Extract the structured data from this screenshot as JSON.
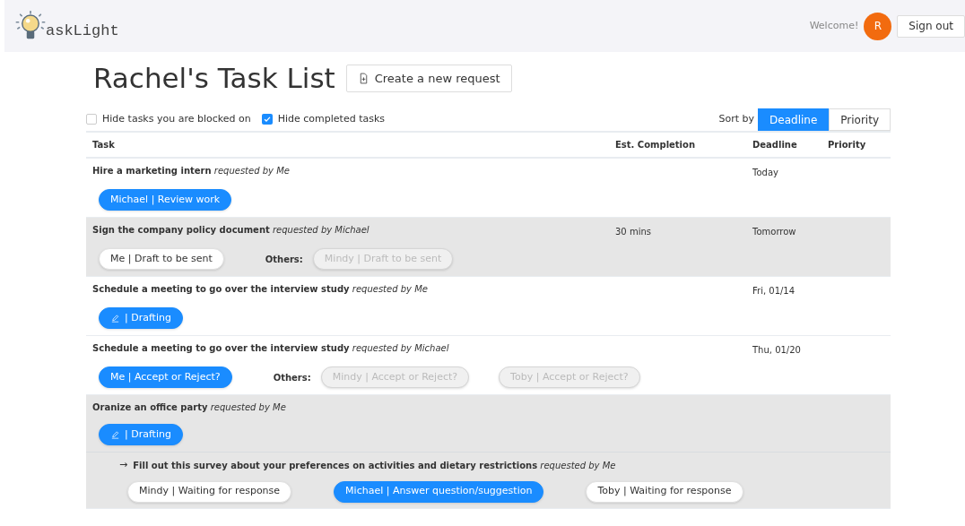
{
  "header": {
    "logo_text": "askLight",
    "welcome": "Welcome!",
    "avatar_initial": "R",
    "sign_out": "Sign out"
  },
  "page_title": "Rachel's Task List",
  "create_button": "Create a new request",
  "filters": [
    {
      "label": "Hide tasks you are blocked on",
      "checked": false
    },
    {
      "label": "Hide completed tasks",
      "checked": true
    }
  ],
  "sort": {
    "label": "Sort by",
    "options": [
      {
        "label": "Deadline",
        "selected": true
      },
      {
        "label": "Priority",
        "selected": false
      }
    ]
  },
  "table": {
    "columns": [
      "Task",
      "Est. Completion",
      "Deadline",
      "Priority"
    ],
    "rows": [
      {
        "title": "**Hire a marketing intern** *requested by Me*",
        "shaded": false,
        "est": "",
        "deadline": "Today",
        "mine": [
          {
            "label": "Michael | Review work",
            "kind": "active",
            "edit_icon": false
          }
        ],
        "others_label": "",
        "others": [],
        "subtasks": []
      },
      {
        "title": "**Sign the company policy document** *requested by Michael*",
        "shaded": true,
        "est": "30 mins",
        "deadline": "Tomorrow",
        "mine": [
          {
            "label": "Me | Draft to be sent",
            "kind": "idle",
            "edit_icon": false
          }
        ],
        "others_label": "Others:",
        "others": [
          {
            "label": "Mindy | Draft to be sent",
            "kind": "muted",
            "edit_icon": false
          }
        ],
        "subtasks": []
      },
      {
        "title": "**Schedule a meeting to go over the interview study** *requested by Me*",
        "shaded": false,
        "est": "",
        "deadline": "Fri, 01/14",
        "mine": [
          {
            "label": "| Drafting",
            "kind": "active",
            "edit_icon": true
          }
        ],
        "others_label": "",
        "others": [],
        "subtasks": []
      },
      {
        "title": "**Schedule a meeting to go over the interview study** *requested by Michael*",
        "shaded": false,
        "est": "",
        "deadline": "Thu, 01/20",
        "mine": [
          {
            "label": "Me | Accept or Reject?",
            "kind": "active",
            "edit_icon": false
          }
        ],
        "others_label": "Others:",
        "others": [
          {
            "label": "Mindy | Accept or Reject?",
            "kind": "muted",
            "edit_icon": false
          },
          {
            "label": "Toby | Accept or Reject?",
            "kind": "muted",
            "edit_icon": false
          }
        ],
        "subtasks": []
      },
      {
        "title": "**Oranize an office party** *requested by Me*",
        "shaded": true,
        "est": "",
        "deadline": "",
        "mine": [
          {
            "label": "| Drafting",
            "kind": "active",
            "edit_icon": true
          }
        ],
        "others_label": "",
        "others": [],
        "subtasks": [
          {
            "arrow": "→",
            "title": "**Fill out this survey about your preferences on activities and dietary restrictions** *requested by Me*",
            "chips": [
              {
                "label": "Mindy | Waiting for response",
                "kind": "idle",
                "edit_icon": false
              },
              {
                "label": "Michael | Answer question/suggestion",
                "kind": "active",
                "edit_icon": false
              },
              {
                "label": "Toby | Waiting for response",
                "kind": "idle",
                "edit_icon": false
              }
            ]
          }
        ]
      }
    ]
  }
}
